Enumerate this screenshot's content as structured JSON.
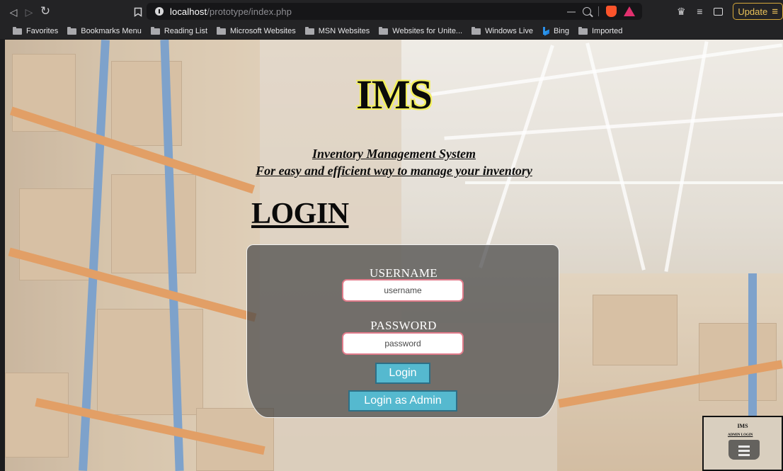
{
  "browser": {
    "url_host": "localhost",
    "url_path": "/prototype/index.php",
    "update_label": "Update",
    "bookmarks": [
      {
        "label": "Favorites",
        "icon": "folder-icon"
      },
      {
        "label": "Bookmarks Menu",
        "icon": "folder-icon"
      },
      {
        "label": "Reading List",
        "icon": "folder-icon"
      },
      {
        "label": "Microsoft Websites",
        "icon": "folder-icon"
      },
      {
        "label": "MSN Websites",
        "icon": "folder-icon"
      },
      {
        "label": "Websites for Unite...",
        "icon": "folder-icon"
      },
      {
        "label": "Windows Live",
        "icon": "folder-icon"
      },
      {
        "label": "Bing",
        "icon": "bing-icon"
      },
      {
        "label": "Imported",
        "icon": "folder-icon"
      }
    ]
  },
  "page": {
    "title": "IMS",
    "subtitle_line1": "Inventory Management System",
    "subtitle_line2": "For easy and efficient way to manage your inventory",
    "login_heading": "LOGIN",
    "username_label": "USERNAME",
    "username_placeholder": "username",
    "password_label": "PASSWORD",
    "password_placeholder": "password",
    "login_button": "Login",
    "admin_button": "Login as Admin"
  },
  "thumbnail": {
    "title": "IMS",
    "heading": "ADMIN LOGIN"
  },
  "colors": {
    "title_outline": "#f3ef5c",
    "button_fill": "#55b9cf",
    "input_border": "#e07b8a",
    "update_accent": "#e9c15a"
  }
}
